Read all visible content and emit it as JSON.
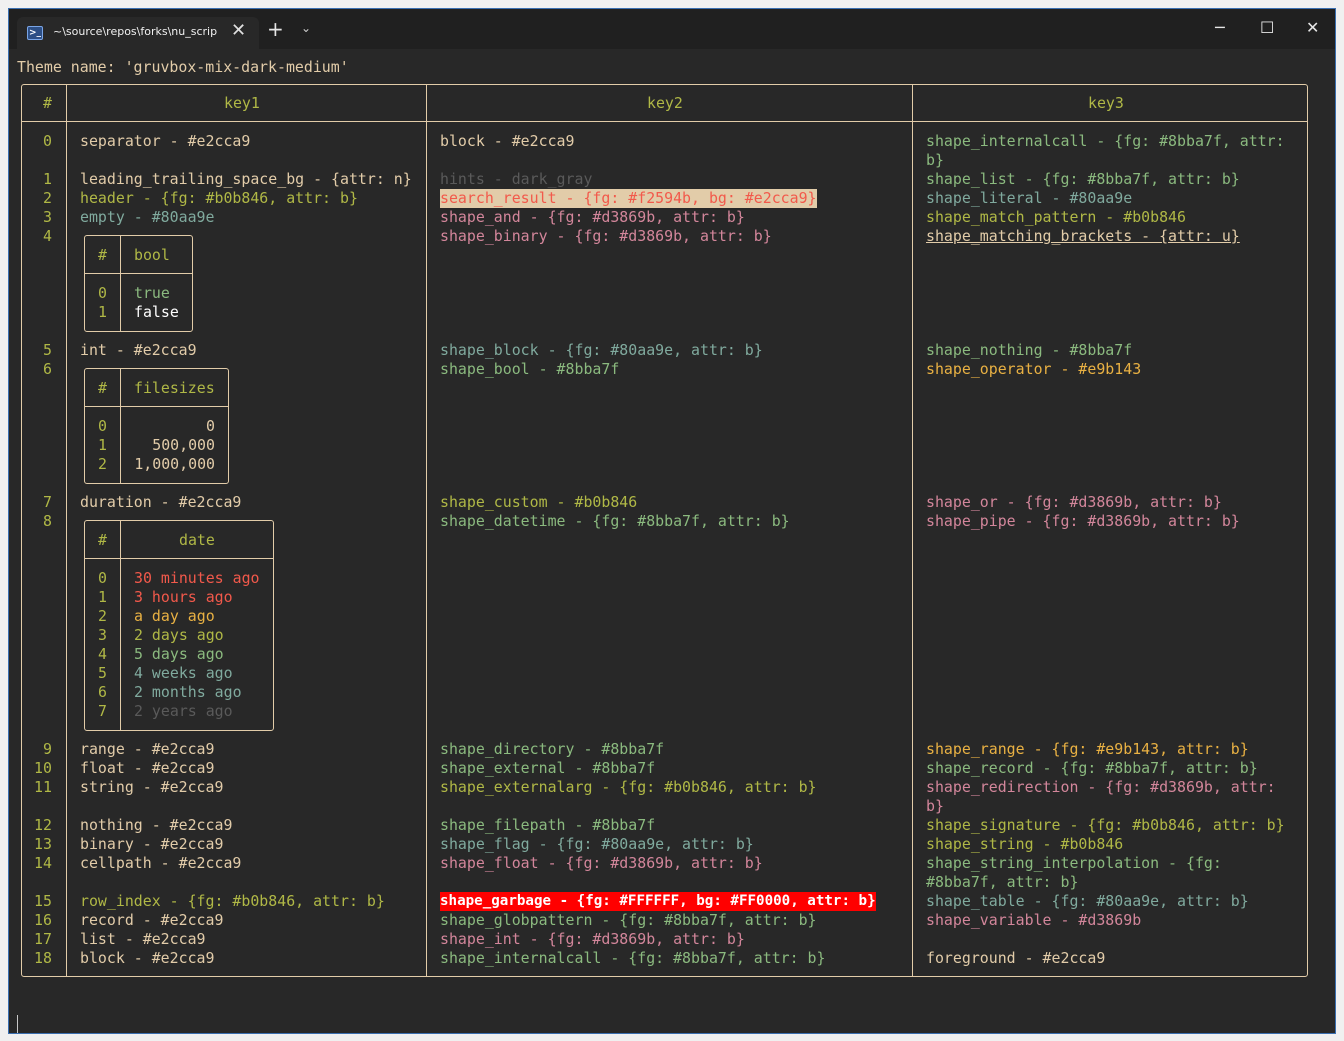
{
  "window": {
    "tab_title": "~\\source\\repos\\forks\\nu_scrip",
    "tab_icon": "powershell-icon",
    "close_glyph": "✕",
    "new_tab_glyph": "+",
    "dropdown_glyph": "⌄",
    "minimize_glyph": "─",
    "maximize_glyph": "☐",
    "window_close_glyph": "✕"
  },
  "colors": {
    "background": "#282828",
    "separator": "#e2cca9",
    "header": "#b0b846",
    "green": "#8bba7f",
    "aqua": "#80aa9e",
    "purple": "#d3869b",
    "orange": "#e9b143",
    "yellow": "#b0b846",
    "red": "#f2594b",
    "gray": "#5a5a5a"
  },
  "theme_line": "Theme name: 'gruvbox-mix-dark-medium'",
  "headers": {
    "index": "#",
    "key1": "key1",
    "key2": "key2",
    "key3": "key3"
  },
  "indices": {
    "i0": "0",
    "i1": "1",
    "i2": "2",
    "i3": "3",
    "i4": "4",
    "i5": "5",
    "i6": "6",
    "i7": "7",
    "i8": "8",
    "i9": "9",
    "i10": "10",
    "i11": "11",
    "i12": "12",
    "i13": "13",
    "i14": "14",
    "i15": "15",
    "i16": "16",
    "i17": "17",
    "i18": "18"
  },
  "key1": {
    "r0": "separator - #e2cca9",
    "r1": "leading_trailing_space_bg - {attr: n}",
    "r2": "header - {fg: #b0b846, attr: b}",
    "r3": "empty - #80aa9e",
    "r5": "int - #e2cca9",
    "r7": "duration - #e2cca9",
    "r9": "range - #e2cca9",
    "r10": "float - #e2cca9",
    "r11": "string - #e2cca9",
    "r12": "nothing - #e2cca9",
    "r13": "binary - #e2cca9",
    "r14": "cellpath - #e2cca9",
    "r15": "row_index - {fg: #b0b846, attr: b}",
    "r16": "record - #e2cca9",
    "r17": "list - #e2cca9",
    "r18": "block - #e2cca9"
  },
  "bool_table": {
    "index_header": "#",
    "header": "bool",
    "rows": [
      {
        "i": "0",
        "v": "true"
      },
      {
        "i": "1",
        "v": "false"
      }
    ]
  },
  "filesizes_table": {
    "index_header": "#",
    "header": "filesizes",
    "rows": [
      {
        "i": "0",
        "v": "0"
      },
      {
        "i": "1",
        "v": "500,000"
      },
      {
        "i": "2",
        "v": "1,000,000"
      }
    ]
  },
  "date_table": {
    "index_header": "#",
    "header": "date",
    "rows": [
      {
        "i": "0",
        "v": "30 minutes ago"
      },
      {
        "i": "1",
        "v": "3 hours ago"
      },
      {
        "i": "2",
        "v": "a day ago"
      },
      {
        "i": "3",
        "v": "2 days ago"
      },
      {
        "i": "4",
        "v": "5 days ago"
      },
      {
        "i": "5",
        "v": "4 weeks ago"
      },
      {
        "i": "6",
        "v": "2 months ago"
      },
      {
        "i": "7",
        "v": "2 years ago"
      }
    ]
  },
  "key2": {
    "r0": "block - #e2cca9",
    "r1": "hints - dark_gray",
    "r2": "search_result - {fg: #f2594b, bg: #e2cca9}",
    "r3": "shape_and - {fg: #d3869b, attr: b}",
    "r4": "shape_binary - {fg: #d3869b, attr: b}",
    "r5": "shape_block - {fg: #80aa9e, attr: b}",
    "r6": "shape_bool - #8bba7f",
    "r7": "shape_custom - #b0b846",
    "r8": "shape_datetime - {fg: #8bba7f, attr: b}",
    "r9": "shape_directory - #8bba7f",
    "r10": "shape_external - #8bba7f",
    "r11": "shape_externalarg - {fg: #b0b846, attr: b}",
    "r12": "shape_filepath - #8bba7f",
    "r13": "shape_flag - {fg: #80aa9e, attr: b}",
    "r14": "shape_float - {fg: #d3869b, attr: b}",
    "r15": "shape_garbage - {fg: #FFFFFF, bg: #FF0000, attr: b}",
    "r16": "shape_globpattern - {fg: #8bba7f, attr: b}",
    "r17": "shape_int - {fg: #d3869b, attr: b}",
    "r18": "shape_internalcall - {fg: #8bba7f, attr: b}"
  },
  "key3": {
    "r0a": "shape_internalcall - {fg: #8bba7f, attr:",
    "r0b": "b}",
    "r1": "shape_list - {fg: #8bba7f, attr: b}",
    "r2": "shape_literal - #80aa9e",
    "r3": "shape_match_pattern - #b0b846",
    "r4": "shape_matching_brackets - {attr: u}",
    "r5": "shape_nothing - #8bba7f",
    "r6": "shape_operator - #e9b143",
    "r7": "shape_or - {fg: #d3869b, attr: b}",
    "r8": "shape_pipe - {fg: #d3869b, attr: b}",
    "r9": "shape_range - {fg: #e9b143, attr: b}",
    "r10": "shape_record - {fg: #8bba7f, attr: b}",
    "r11a": "shape_redirection - {fg: #d3869b, attr:",
    "r11b": "b}",
    "r12": "shape_signature - {fg: #b0b846, attr: b}",
    "r13": "shape_string - #b0b846",
    "r14a": "shape_string_interpolation - {fg:",
    "r14b": "#8bba7f, attr: b}",
    "r15": "shape_table - {fg: #80aa9e, attr: b}",
    "r16": "shape_variable - #d3869b",
    "r18": "foreground - #e2cca9"
  }
}
